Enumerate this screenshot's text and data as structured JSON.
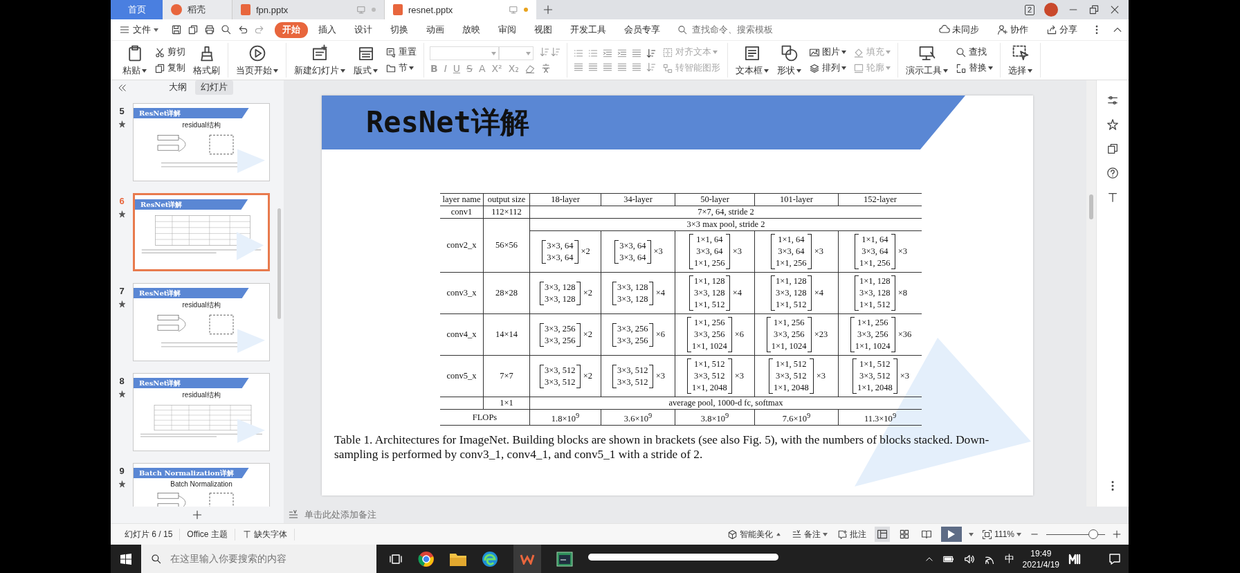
{
  "tabs": [
    {
      "label": "首页",
      "kind": "home",
      "selected": false
    },
    {
      "label": "稻壳",
      "kind": "docer",
      "selected": false
    },
    {
      "label": "fpn.pptx",
      "kind": "file",
      "selected": false,
      "modified": false
    },
    {
      "label": "resnet.pptx",
      "kind": "file",
      "selected": true,
      "modified": true
    }
  ],
  "window_badge": "2",
  "menu": {
    "file": "文件",
    "tabs": [
      {
        "label": "开始",
        "selected": true
      },
      {
        "label": "插入",
        "selected": false
      },
      {
        "label": "设计",
        "selected": false
      },
      {
        "label": "切换",
        "selected": false
      },
      {
        "label": "动画",
        "selected": false
      },
      {
        "label": "放映",
        "selected": false
      },
      {
        "label": "审阅",
        "selected": false
      },
      {
        "label": "视图",
        "selected": false
      },
      {
        "label": "开发工具",
        "selected": false
      },
      {
        "label": "会员专享",
        "selected": false
      }
    ],
    "search": {
      "placeholder": "查找命令、搜索模板"
    },
    "actions": [
      "未同步",
      "协作",
      "分享"
    ]
  },
  "ribbon": [
    {
      "kind": "buttons",
      "columns": [
        [
          {
            "label": "粘贴",
            "menu": true
          }
        ],
        [
          {
            "label": "剪切"
          },
          {
            "label": "复制"
          }
        ],
        [
          {
            "label": "格式刷"
          }
        ]
      ]
    },
    {
      "kind": "buttons",
      "columns": [
        [
          {
            "label": "当页开始",
            "menu": true
          }
        ]
      ]
    },
    {
      "kind": "buttons",
      "columns": [
        [
          {
            "label": "新建幻灯片",
            "menu": true
          }
        ],
        [
          {
            "label": "版式",
            "menu": true
          }
        ],
        [
          {
            "label": "重置"
          },
          {
            "label": "节",
            "menu": true
          }
        ]
      ]
    },
    {
      "kind": "font",
      "format_buttons": [
        "B",
        "I",
        "U",
        "S",
        "A",
        "X²",
        "X₂"
      ]
    },
    {
      "kind": "paragraph",
      "columns": [
        [
          {
            "label": "对齐文本",
            "menu": true,
            "disabled": true
          },
          {
            "label": "转智能图形",
            "disabled": true
          }
        ]
      ]
    },
    {
      "kind": "buttons",
      "columns": [
        [
          {
            "label": "文本框",
            "menu": true
          }
        ],
        [
          {
            "label": "形状",
            "menu": true
          }
        ],
        [
          {
            "label": "图片",
            "menu": true
          },
          {
            "label": "排列",
            "menu": true
          }
        ],
        [
          {
            "label": "填充",
            "menu": true,
            "disabled": true
          },
          {
            "label": "轮廓",
            "menu": true,
            "disabled": true
          }
        ]
      ]
    },
    {
      "kind": "buttons",
      "columns": [
        [
          {
            "label": "演示工具",
            "menu": true
          }
        ],
        [
          {
            "label": "查找"
          },
          {
            "label": "替换",
            "menu": true
          }
        ]
      ]
    },
    {
      "kind": "buttons",
      "columns": [
        [
          {
            "label": "选择",
            "menu": true
          }
        ]
      ]
    }
  ],
  "panel": {
    "tabs": [
      {
        "label": "大纲",
        "selected": false
      },
      {
        "label": "幻灯片",
        "selected": true
      }
    ],
    "slides": [
      {
        "number": "5",
        "title": "ResNet详解",
        "subtitle": "residual结构",
        "selected": false
      },
      {
        "number": "6",
        "title": "ResNet详解",
        "selected": true
      },
      {
        "number": "7",
        "title": "ResNet详解",
        "subtitle": "residual结构",
        "selected": false
      },
      {
        "number": "8",
        "title": "ResNet详解",
        "subtitle": "residual结构",
        "selected": false
      },
      {
        "number": "9",
        "title": "Batch Normalization详解",
        "subtitle": "Batch Normalization",
        "selected": false
      }
    ]
  },
  "slide": {
    "title": "ResNet详解",
    "table": {
      "columns": [
        "layer name",
        "output size",
        "18-layer",
        "34-layer",
        "50-layer",
        "101-layer",
        "152-layer"
      ],
      "rows": [
        {
          "kind": "span",
          "layer": "conv1",
          "output": "112×112",
          "text": "7×7, 64, stride 2"
        },
        {
          "kind": "stage",
          "layer": "conv2_x",
          "output": "56×56",
          "pre": "3×3 max pool, stride 2",
          "blocks": [
            {
              "lines": [
                "3×3, 64",
                "3×3, 64"
              ],
              "times": "×2"
            },
            {
              "lines": [
                "3×3, 64",
                "3×3, 64"
              ],
              "times": "×3"
            },
            {
              "lines": [
                "1×1, 64",
                "3×3, 64",
                "1×1, 256"
              ],
              "times": "×3"
            },
            {
              "lines": [
                "1×1, 64",
                "3×3, 64",
                "1×1, 256"
              ],
              "times": "×3"
            },
            {
              "lines": [
                "1×1, 64",
                "3×3, 64",
                "1×1, 256"
              ],
              "times": "×3"
            }
          ]
        },
        {
          "kind": "stage",
          "layer": "conv3_x",
          "output": "28×28",
          "blocks": [
            {
              "lines": [
                "3×3, 128",
                "3×3, 128"
              ],
              "times": "×2"
            },
            {
              "lines": [
                "3×3, 128",
                "3×3, 128"
              ],
              "times": "×4"
            },
            {
              "lines": [
                "1×1, 128",
                "3×3, 128",
                "1×1, 512"
              ],
              "times": "×4"
            },
            {
              "lines": [
                "1×1, 128",
                "3×3, 128",
                "1×1, 512"
              ],
              "times": "×4"
            },
            {
              "lines": [
                "1×1, 128",
                "3×3, 128",
                "1×1, 512"
              ],
              "times": "×8"
            }
          ]
        },
        {
          "kind": "stage",
          "layer": "conv4_x",
          "output": "14×14",
          "blocks": [
            {
              "lines": [
                "3×3, 256",
                "3×3, 256"
              ],
              "times": "×2"
            },
            {
              "lines": [
                "3×3, 256",
                "3×3, 256"
              ],
              "times": "×6"
            },
            {
              "lines": [
                "1×1, 256",
                "3×3, 256",
                "1×1, 1024"
              ],
              "times": "×6"
            },
            {
              "lines": [
                "1×1, 256",
                "3×3, 256",
                "1×1, 1024"
              ],
              "times": "×23"
            },
            {
              "lines": [
                "1×1, 256",
                "3×3, 256",
                "1×1, 1024"
              ],
              "times": "×36"
            }
          ]
        },
        {
          "kind": "stage",
          "layer": "conv5_x",
          "output": "7×7",
          "blocks": [
            {
              "lines": [
                "3×3, 512",
                "3×3, 512"
              ],
              "times": "×2"
            },
            {
              "lines": [
                "3×3, 512",
                "3×3, 512"
              ],
              "times": "×3"
            },
            {
              "lines": [
                "1×1, 512",
                "3×3, 512",
                "1×1, 2048"
              ],
              "times": "×3"
            },
            {
              "lines": [
                "1×1, 512",
                "3×3, 512",
                "1×1, 2048"
              ],
              "times": "×3"
            },
            {
              "lines": [
                "1×1, 512",
                "3×3, 512",
                "1×1, 2048"
              ],
              "times": "×3"
            }
          ]
        },
        {
          "kind": "span",
          "output": "1×1",
          "text": "average pool, 1000-d fc, softmax"
        },
        {
          "kind": "values",
          "label": "FLOPs",
          "values": [
            "1.8×10$^{9}$",
            "3.6×10$^{9}$",
            "3.8×10$^{9}$",
            "7.6×10$^{9}$",
            "11.3×10$^{9}$"
          ]
        }
      ]
    },
    "caption": "Table 1. Architectures for ImageNet. Building blocks are shown in brackets (see also Fig. 5), with the numbers of blocks stacked. Down-sampling is performed by conv3_1, conv4_1, and conv5_1 with a stride of 2."
  },
  "notes": {
    "placeholder": "单击此处添加备注"
  },
  "status": {
    "left": [
      "幻灯片 6 / 15",
      "Office 主题",
      "缺失字体"
    ],
    "beautify": "智能美化",
    "notes": "备注",
    "comments": "批注",
    "views": [
      {
        "selected": true
      },
      {
        "selected": false
      },
      {
        "selected": false
      }
    ],
    "zoom": "111%",
    "zoom_level": {
      "level": 0.8
    }
  },
  "taskbar": {
    "search": {
      "placeholder": "在这里输入你要搜索的内容"
    },
    "video_progress": {
      "level": 1
    },
    "ime": "中",
    "time": "19:49",
    "date": "2021/4/19"
  }
}
